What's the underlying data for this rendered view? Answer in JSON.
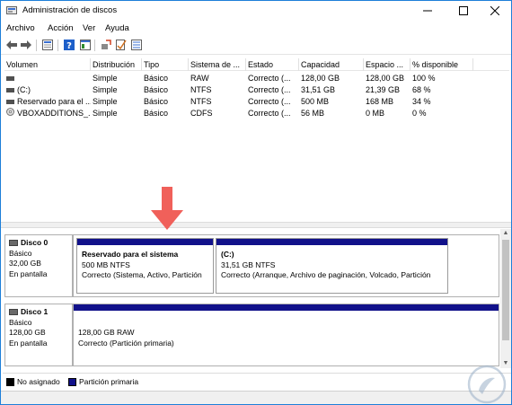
{
  "window": {
    "title": "Administración de discos"
  },
  "menu": {
    "items": [
      "Archivo",
      "Acción",
      "Ver",
      "Ayuda"
    ]
  },
  "toolbar": {
    "icons": [
      "back-icon",
      "forward-icon",
      "properties-icon",
      "help-icon",
      "console-icon",
      "rescan-icon",
      "settings-icon",
      "check-icon",
      "list-view-icon"
    ]
  },
  "volumes": {
    "headers": [
      "Volumen",
      "Distribución",
      "Tipo",
      "Sistema de ...",
      "Estado",
      "Capacidad",
      "Espacio ...",
      "% disponible"
    ],
    "rows": [
      {
        "volume": "",
        "layout": "Simple",
        "type": "Básico",
        "fs": "RAW",
        "status": "Correcto (...",
        "capacity": "128,00 GB",
        "free": "128,00 GB",
        "pct": "100 %"
      },
      {
        "volume": "(C:)",
        "layout": "Simple",
        "type": "Básico",
        "fs": "NTFS",
        "status": "Correcto (...",
        "capacity": "31,51 GB",
        "free": "21,39 GB",
        "pct": "68 %"
      },
      {
        "volume": "Reservado para el ...",
        "layout": "Simple",
        "type": "Básico",
        "fs": "NTFS",
        "status": "Correcto (...",
        "capacity": "500 MB",
        "free": "168 MB",
        "pct": "34 %"
      },
      {
        "volume": "VBOXADDITIONS_...",
        "layout": "Simple",
        "type": "Básico",
        "fs": "CDFS",
        "status": "Correcto (...",
        "capacity": "56 MB",
        "free": "0 MB",
        "pct": "0 %"
      }
    ]
  },
  "disks": [
    {
      "name": "Disco 0",
      "kind": "Básico",
      "size": "32,00 GB",
      "state": "En pantalla",
      "partitions": [
        {
          "title": "Reservado para el sistema",
          "size": "500 MB NTFS",
          "status": "Correcto (Sistema, Activo, Partición"
        },
        {
          "title": "(C:)",
          "size": "31,51 GB NTFS",
          "status": "Correcto (Arranque, Archivo de paginación, Volcado, Partición"
        }
      ]
    },
    {
      "name": "Disco 1",
      "kind": "Básico",
      "size": "128,00 GB",
      "state": "En pantalla",
      "partitions": [
        {
          "title": "",
          "size": "128,00 GB RAW",
          "status": "Correcto (Partición primaria)"
        }
      ]
    }
  ],
  "legend": {
    "unallocated": "No asignado",
    "primary": "Partición primaria",
    "colors": {
      "unallocated": "#000000",
      "primary": "#11118a"
    }
  },
  "colors": {
    "accent": "#1e7fd9",
    "partition_bar": "#11118a",
    "annotation_arrow": "#f0605a"
  }
}
